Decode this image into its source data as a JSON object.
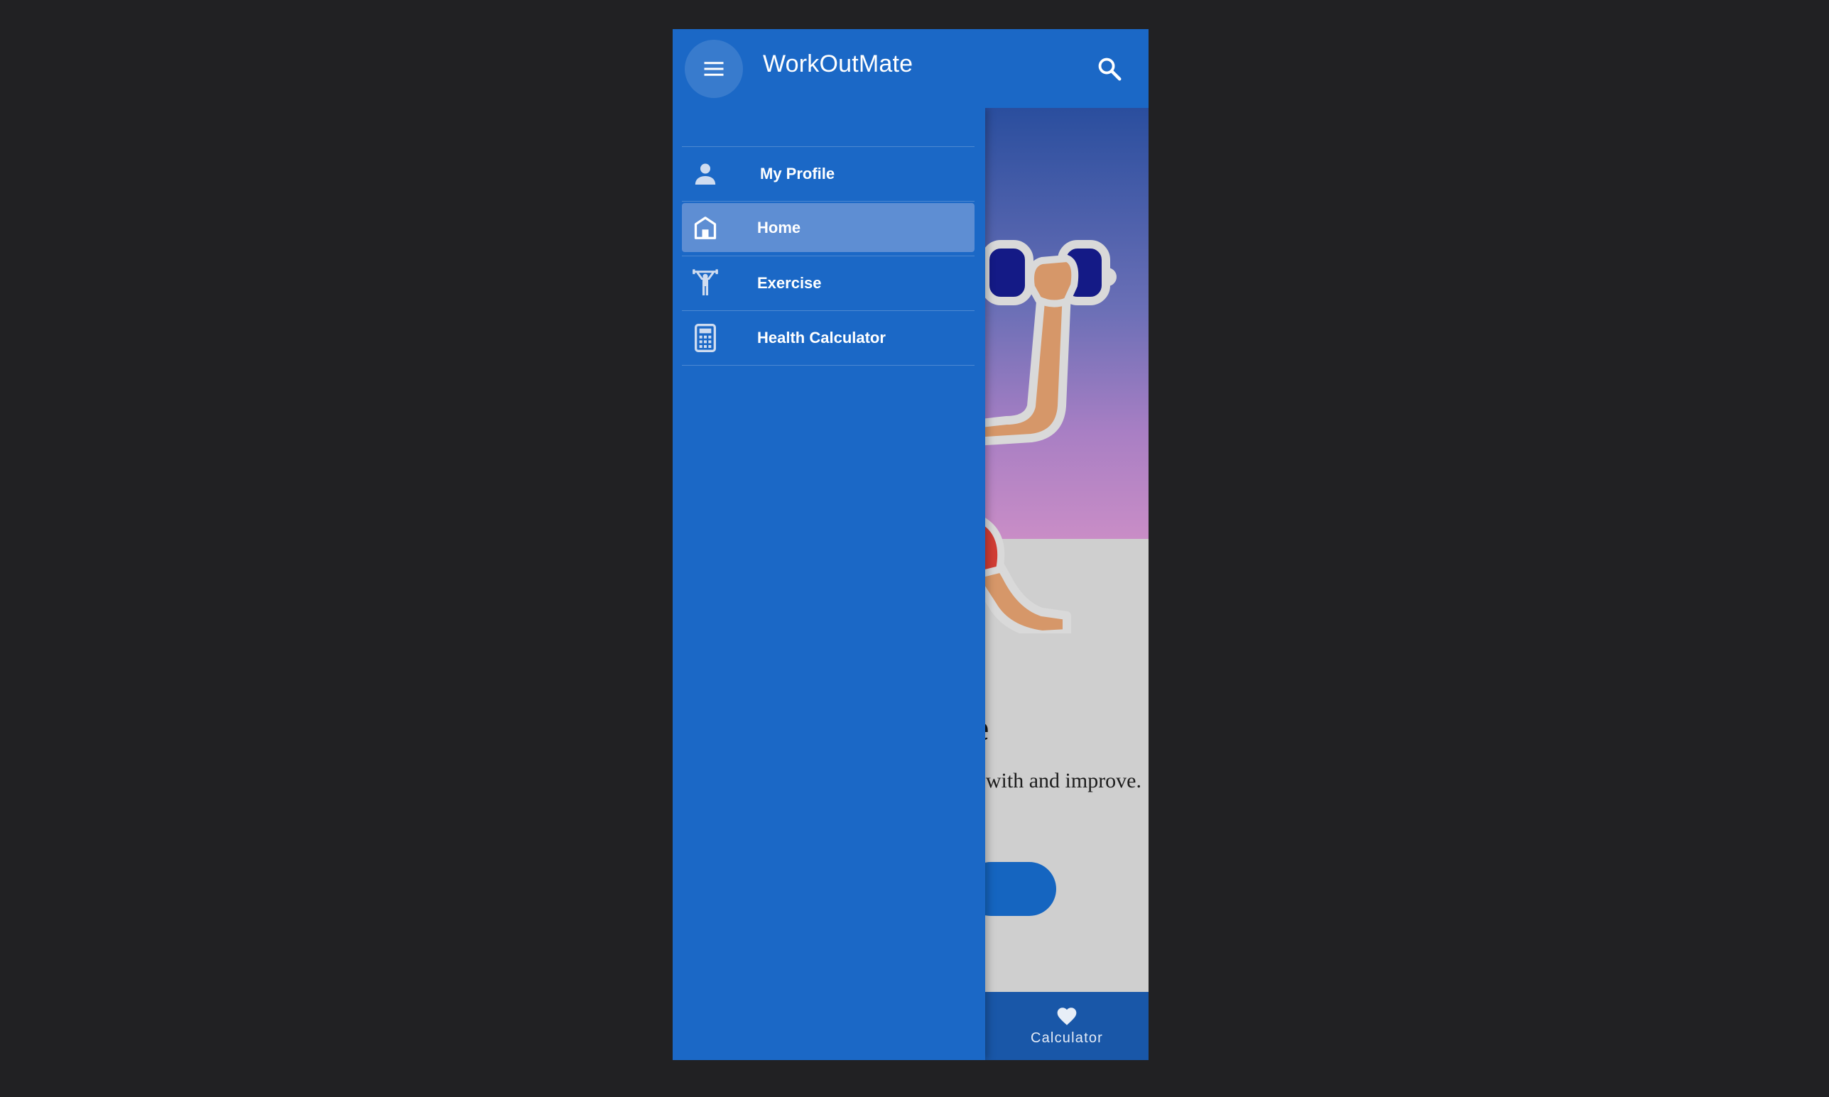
{
  "app": {
    "title": "WorkOutMate"
  },
  "hero": {
    "title_partial": "ate",
    "description_partial": "ss routine with and improve."
  },
  "bottom_nav": {
    "calculator_label": "Calculator"
  },
  "drawer": {
    "items": [
      {
        "label": "My Profile",
        "icon": "person-icon",
        "active": false
      },
      {
        "label": "Home",
        "icon": "home-icon",
        "active": true
      },
      {
        "label": "Exercise",
        "icon": "weightlifter-icon",
        "active": false
      },
      {
        "label": "Health Calculator",
        "icon": "calculator-icon",
        "active": false
      }
    ]
  },
  "colors": {
    "primary": "#1b68c6",
    "active_item": "#5e8ed3",
    "bottom_nav": "#1957a8",
    "screen_background": "#212123"
  }
}
